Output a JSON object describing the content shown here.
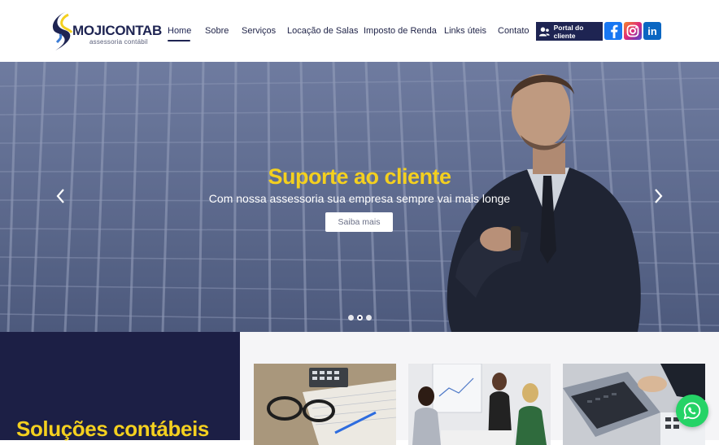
{
  "brand": {
    "name": "MOJICONTAB",
    "tagline": "assessoria contábil",
    "primary_color": "#1e2452",
    "accent_color": "#f4d01f"
  },
  "nav": {
    "items": [
      {
        "label": "Home",
        "active": true
      },
      {
        "label": "Sobre"
      },
      {
        "label": "Serviços"
      },
      {
        "label": "Locação de Salas"
      },
      {
        "label": "Imposto de Renda"
      },
      {
        "label": "Links úteis"
      },
      {
        "label": "Contato"
      }
    ],
    "portal_label": "Portal do cliente"
  },
  "social": {
    "facebook_icon": "facebook-icon",
    "instagram_icon": "instagram-icon",
    "linkedin_label": "in"
  },
  "hero": {
    "title": "Suporte ao cliente",
    "subtitle": "Com nossa assessoria sua empresa sempre vai mais longe",
    "button_label": "Saiba mais",
    "slide_count": 3,
    "active_slide": 1
  },
  "solutions": {
    "title": "Soluções contábeis"
  }
}
